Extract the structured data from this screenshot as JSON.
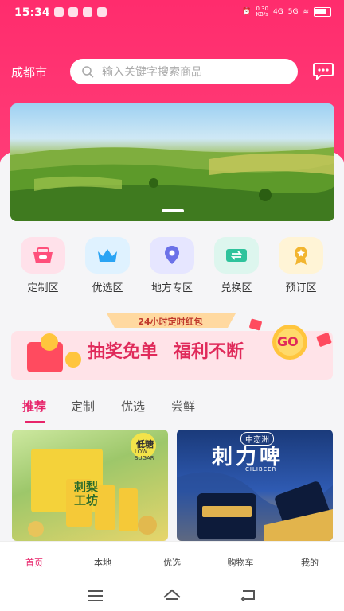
{
  "status_bar": {
    "time": "15:34",
    "speed": "0.30\nKB/s",
    "network": "4G",
    "network2": "5G"
  },
  "header": {
    "city": "成都市",
    "search_placeholder": "输入关键字搜索商品"
  },
  "categories": [
    {
      "label": "定制区",
      "icon": "basket-icon",
      "bg": "#ffe1ea",
      "fg": "#ff4f7b"
    },
    {
      "label": "优选区",
      "icon": "crown-icon",
      "bg": "#dff2ff",
      "fg": "#2aa4f4"
    },
    {
      "label": "地方专区",
      "icon": "location-pin-icon",
      "bg": "#e6e6ff",
      "fg": "#6c72e8"
    },
    {
      "label": "兑换区",
      "icon": "ticket-icon",
      "bg": "#ddf6ee",
      "fg": "#2fc39c"
    },
    {
      "label": "预订区",
      "icon": "medal-icon",
      "bg": "#fff4d6",
      "fg": "#f2b530"
    }
  ],
  "promo": {
    "tag": "24小时定时红包",
    "headline_left": "抽奖免单",
    "headline_right": "福利不断",
    "go": "GO"
  },
  "tabs": [
    "推荐",
    "定制",
    "优选",
    "尝鲜"
  ],
  "products": [
    {
      "brand": "刺梨工坊",
      "badge": "低糖",
      "badge_en": "LOW\nSUGAR"
    },
    {
      "brand": "刺力啤",
      "brand_tag": "中恋洲",
      "sub": "CILIBEER"
    }
  ],
  "bottom_nav": [
    "首页",
    "本地",
    "优选",
    "购物车",
    "我的"
  ],
  "colors": {
    "accent": "#e7246a",
    "header": "#ff2c6d"
  }
}
